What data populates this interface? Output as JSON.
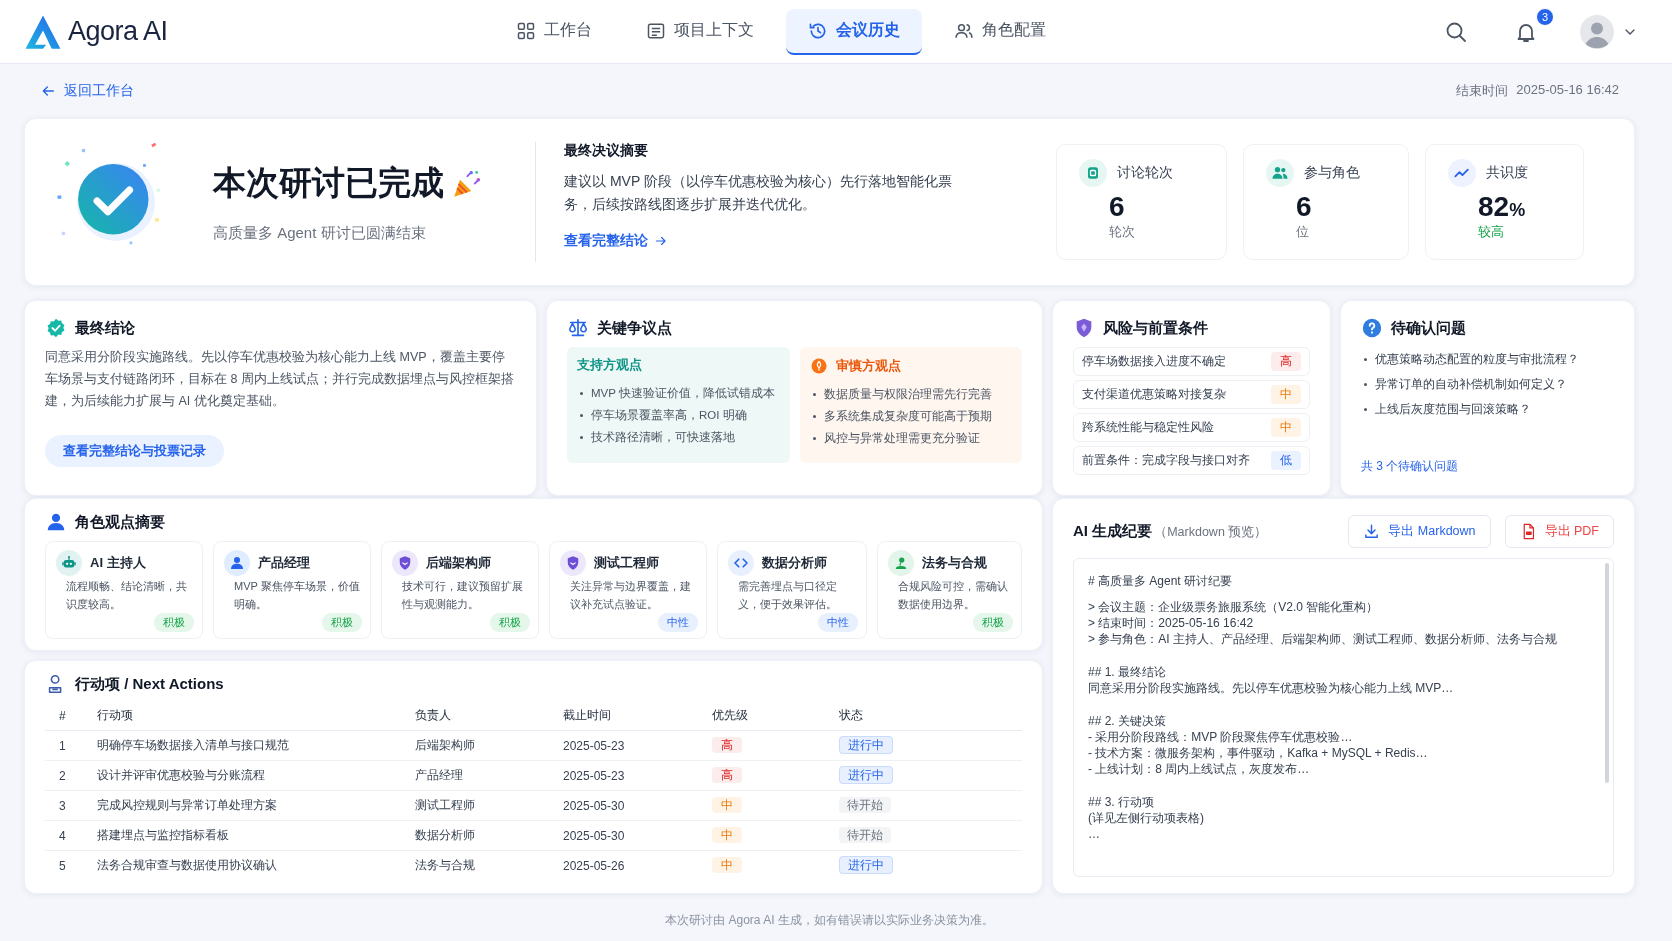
{
  "header": {
    "logo": "Agora AI",
    "nav": [
      {
        "kind": "grid",
        "label": "工作台",
        "selected": false
      },
      {
        "kind": "context",
        "label": "项目上下文",
        "selected": false
      },
      {
        "kind": "history",
        "label": "会议历史",
        "selected": true
      },
      {
        "kind": "roles",
        "label": "角色配置",
        "selected": false
      }
    ],
    "notifications": "3"
  },
  "back_link": "返回工作台",
  "end_time": {
    "label": "结束时间",
    "value": "2025-05-16 16:42"
  },
  "hero": {
    "title": "本次研讨已完成",
    "subtitle": "高质量多 Agent 研讨已圆满结束",
    "decision_title": "最终决议摘要",
    "decision_text": "建议以 MVP 阶段（以停车优惠校验为核心）先行落地智能化票务，后续按路线图逐步扩展并迭代优化。",
    "decision_link": "查看完整结论",
    "stats": [
      {
        "kind": "rounds",
        "label": "讨论轮次",
        "value": "6",
        "caption": "轮次"
      },
      {
        "kind": "roles",
        "label": "参与角色",
        "value": "6",
        "caption": "位"
      },
      {
        "kind": "consensus",
        "label": "共识度",
        "value": "82",
        "unit": "%",
        "caption": "较高"
      }
    ]
  },
  "conclusion": {
    "title": "最终结论",
    "text": "同意采用分阶段实施路线。先以停车优惠校验为核心能力上线 MVP，覆盖主要停车场景与支付链路闭环，目标在 8 周内上线试点；并行完成数据埋点与风控框架搭建，为后续能力扩展与 AI 优化奠定基础。",
    "button": "查看完整结论与投票记录"
  },
  "key_points": {
    "title": "关键争议点",
    "support": {
      "title": "支持方观点",
      "items": [
        "MVP 快速验证价值，降低试错成本",
        "停车场景覆盖率高，ROI 明确",
        "技术路径清晰，可快速落地"
      ]
    },
    "caution": {
      "title": "审慎方观点",
      "items": [
        "数据质量与权限治理需先行完善",
        "多系统集成复杂度可能高于预期",
        "风控与异常处理需更充分验证"
      ]
    }
  },
  "risks": {
    "title": "风险与前置条件",
    "items": [
      {
        "text": "停车场数据接入进度不确定",
        "level": "高",
        "kind": "high"
      },
      {
        "text": "支付渠道优惠策略对接复杂",
        "level": "中",
        "kind": "medium"
      },
      {
        "text": "跨系统性能与稳定性风险",
        "level": "中",
        "kind": "medium"
      },
      {
        "text": "前置条件：完成字段与接口对齐",
        "level": "低",
        "kind": "low"
      }
    ]
  },
  "pending": {
    "title": "待确认问题",
    "items": [
      "优惠策略动态配置的粒度与审批流程？",
      "异常订单的自动补偿机制如何定义？",
      "上线后灰度范围与回滚策略？"
    ],
    "summary": "共 3 个待确认问题"
  },
  "roles": {
    "title": "角色观点摘要",
    "items": [
      {
        "kind": "robot",
        "name": "AI 主持人",
        "text": "流程顺畅、结论清晰，共识度较高。",
        "stance": {
          "label": "积极",
          "kind": "positive"
        }
      },
      {
        "kind": "person",
        "name": "产品经理",
        "text": "MVP 聚焦停车场景，价值明确。",
        "stance": {
          "label": "积极",
          "kind": "positive"
        }
      },
      {
        "kind": "shield",
        "name": "后端架构师",
        "text": "技术可行，建议预留扩展性与观测能力。",
        "stance": {
          "label": "积极",
          "kind": "positive"
        }
      },
      {
        "kind": "shield",
        "name": "测试工程师",
        "text": "关注异常与边界覆盖，建议补充试点验证。",
        "stance": {
          "label": "中性",
          "kind": "neutral"
        }
      },
      {
        "kind": "code",
        "name": "数据分析师",
        "text": "需完善埋点与口径定义，便于效果评估。",
        "stance": {
          "label": "中性",
          "kind": "neutral"
        }
      },
      {
        "kind": "legal",
        "name": "法务与合规",
        "text": "合规风险可控，需确认数据使用边界。",
        "stance": {
          "label": "积极",
          "kind": "positive"
        }
      }
    ]
  },
  "actions": {
    "title": "行动项 / Next Actions",
    "columns": [
      "#",
      "行动项",
      "负责人",
      "截止时间",
      "优先级",
      "状态"
    ],
    "rows": [
      {
        "num": "1",
        "task": "明确停车场数据接入清单与接口规范",
        "owner": "后端架构师",
        "due": "2025-05-23",
        "priority": {
          "label": "高",
          "kind": "high"
        },
        "status": {
          "label": "进行中",
          "kind": "active"
        }
      },
      {
        "num": "2",
        "task": "设计并评审优惠校验与分账流程",
        "owner": "产品经理",
        "due": "2025-05-23",
        "priority": {
          "label": "高",
          "kind": "high"
        },
        "status": {
          "label": "进行中",
          "kind": "active"
        }
      },
      {
        "num": "3",
        "task": "完成风控规则与异常订单处理方案",
        "owner": "测试工程师",
        "due": "2025-05-30",
        "priority": {
          "label": "中",
          "kind": "medium"
        },
        "status": {
          "label": "待开始",
          "kind": "pending"
        }
      },
      {
        "num": "4",
        "task": "搭建埋点与监控指标看板",
        "owner": "数据分析师",
        "due": "2025-05-30",
        "priority": {
          "label": "中",
          "kind": "medium"
        },
        "status": {
          "label": "待开始",
          "kind": "pending"
        }
      },
      {
        "num": "5",
        "task": "法务合规审查与数据使用协议确认",
        "owner": "法务与合规",
        "due": "2025-05-26",
        "priority": {
          "label": "中",
          "kind": "medium"
        },
        "status": {
          "label": "进行中",
          "kind": "active"
        }
      }
    ]
  },
  "minutes": {
    "title": "AI 生成纪要",
    "subtitle": "（Markdown 预览）",
    "buttons": [
      {
        "kind": "download",
        "label": "导出 Markdown"
      },
      {
        "kind": "pdf",
        "label": "导出 PDF"
      }
    ],
    "blocks": [
      [
        "# 高质量多 Agent 研讨纪要"
      ],
      [
        "> 会议主题：企业级票务旅服系统（V2.0 智能化重构）",
        "> 结束时间：2025-05-16 16:42",
        "> 参与角色：AI 主持人、产品经理、后端架构师、测试工程师、数据分析师、法务与合规"
      ],
      [
        "## 1. 最终结论",
        "同意采用分阶段实施路线。先以停车优惠校验为核心能力上线 MVP…"
      ],
      [
        "## 2. 关键决策",
        "- 采用分阶段路线：MVP 阶段聚焦停车优惠校验…",
        "- 技术方案：微服务架构，事件驱动，Kafka + MySQL + Redis…",
        "- 上线计划：8 周内上线试点，灰度发布…"
      ],
      [
        "## 3. 行动项",
        "(详见左侧行动项表格)",
        "…"
      ]
    ]
  },
  "footer": "本次研讨由 Agora AI 生成，如有错误请以实际业务决策为准。"
}
